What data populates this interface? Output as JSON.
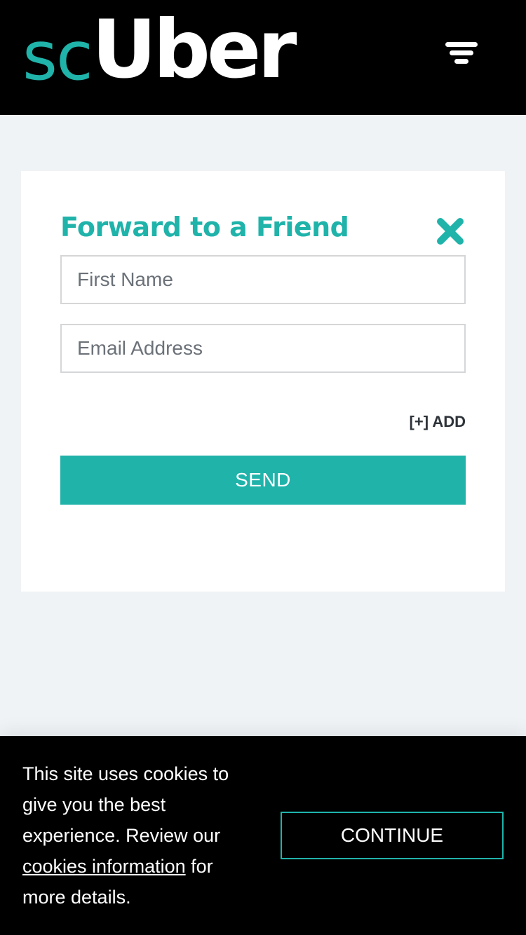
{
  "colors": {
    "brand_teal": "#1fb3aa",
    "header_bg": "#000000",
    "page_bg": "#eff3f6",
    "card_bg": "#ffffff",
    "banner_bg": "#000000",
    "button_text": "#ffffff"
  },
  "header": {
    "logo_part1": "sc",
    "logo_part2": "Uber",
    "menu_icon": "hamburger-filter-icon"
  },
  "modal": {
    "title": "Forward to a Friend",
    "close_icon": "close-x-icon",
    "first_name_placeholder": "First Name",
    "first_name_value": "",
    "email_placeholder": "Email Address",
    "email_value": "",
    "add_label": "[+] ADD",
    "send_label": "SEND"
  },
  "cookie_banner": {
    "text_before": "This site uses cookies to give you the best experience. Review our ",
    "link_text": "cookies information",
    "text_after": " for more details.",
    "continue_label": "CONTINUE"
  }
}
